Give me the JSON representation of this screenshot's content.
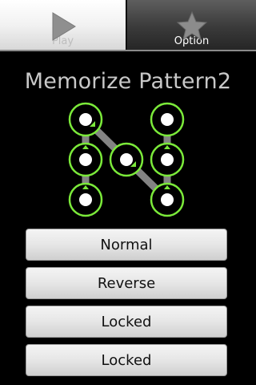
{
  "tabs": [
    {
      "label": "Play",
      "icon": "play-icon",
      "selected": false
    },
    {
      "label": "Option",
      "icon": "star-icon",
      "selected": true
    }
  ],
  "title": "Memorize Pattern2",
  "pattern": {
    "grid": "3x3",
    "sequence": [
      "top-left",
      "middle-center",
      "bottom-right",
      "middle-right",
      "top-right"
    ],
    "also_lit": [
      "middle-left",
      "bottom-left"
    ],
    "colors": {
      "ring": "#7bea3a",
      "line": "#9a9a9a",
      "dot": "#ffffff"
    }
  },
  "buttons": [
    {
      "label": "Normal"
    },
    {
      "label": "Reverse"
    },
    {
      "label": "Locked"
    },
    {
      "label": "Locked"
    }
  ]
}
